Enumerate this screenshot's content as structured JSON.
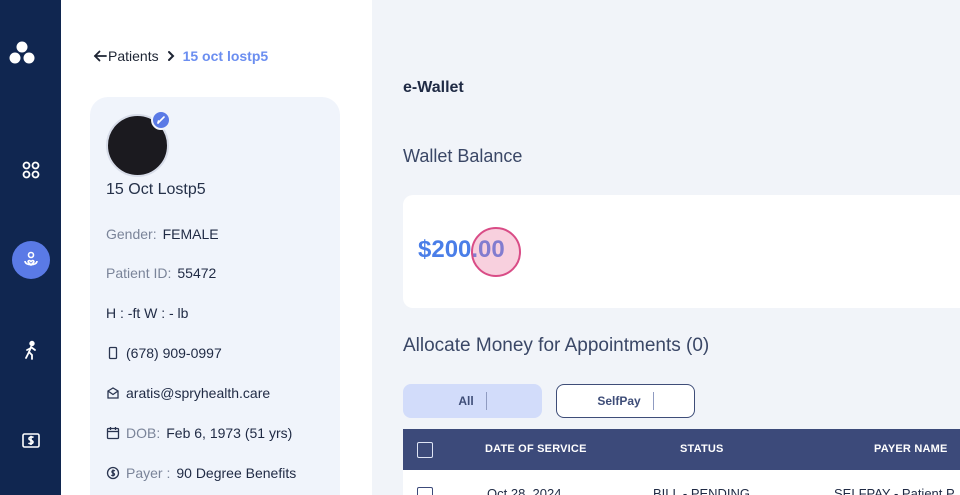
{
  "breadcrumb": {
    "back_label": "Patients",
    "current": "15 oct lostp5"
  },
  "patient": {
    "name": "15 Oct Lostp5",
    "gender_label": "Gender:",
    "gender_value": "FEMALE",
    "id_label": "Patient ID:",
    "id_value": "55472",
    "hw": "H : -ft W : - lb",
    "phone": "(678) 909-0997",
    "email": "aratis@spryhealth.care",
    "dob_label": "DOB:",
    "dob_value": "Feb 6, 1973 (51 yrs)",
    "payer_label": "Payer :",
    "payer_value": "90 Degree Benefits"
  },
  "main": {
    "title": "e-Wallet",
    "wallet_balance_title": "Wallet Balance",
    "balance": "$200.00",
    "allocate_title": "Allocate Money for Appointments (0)",
    "filters": [
      "All",
      "SelfPay"
    ],
    "table": {
      "headers": [
        "DATE OF SERVICE",
        "STATUS",
        "PAYER NAME"
      ],
      "rows": [
        [
          "Oct 28, 2024",
          "BILL - PENDING",
          "SELFPAY - Patient P"
        ]
      ]
    }
  },
  "colors": {
    "nav_bg": "#102650",
    "accent": "#5a7ae6",
    "balance": "#4a7ee8",
    "table_header": "#3c4a7a"
  },
  "icons": [
    "app-logo-icon",
    "dashboard-icon",
    "patient-icon",
    "walking-icon",
    "billing-icon",
    "arrow-left-icon",
    "chevron-right-icon",
    "edit-icon",
    "phone-icon",
    "mail-icon",
    "calendar-icon",
    "payer-icon"
  ]
}
